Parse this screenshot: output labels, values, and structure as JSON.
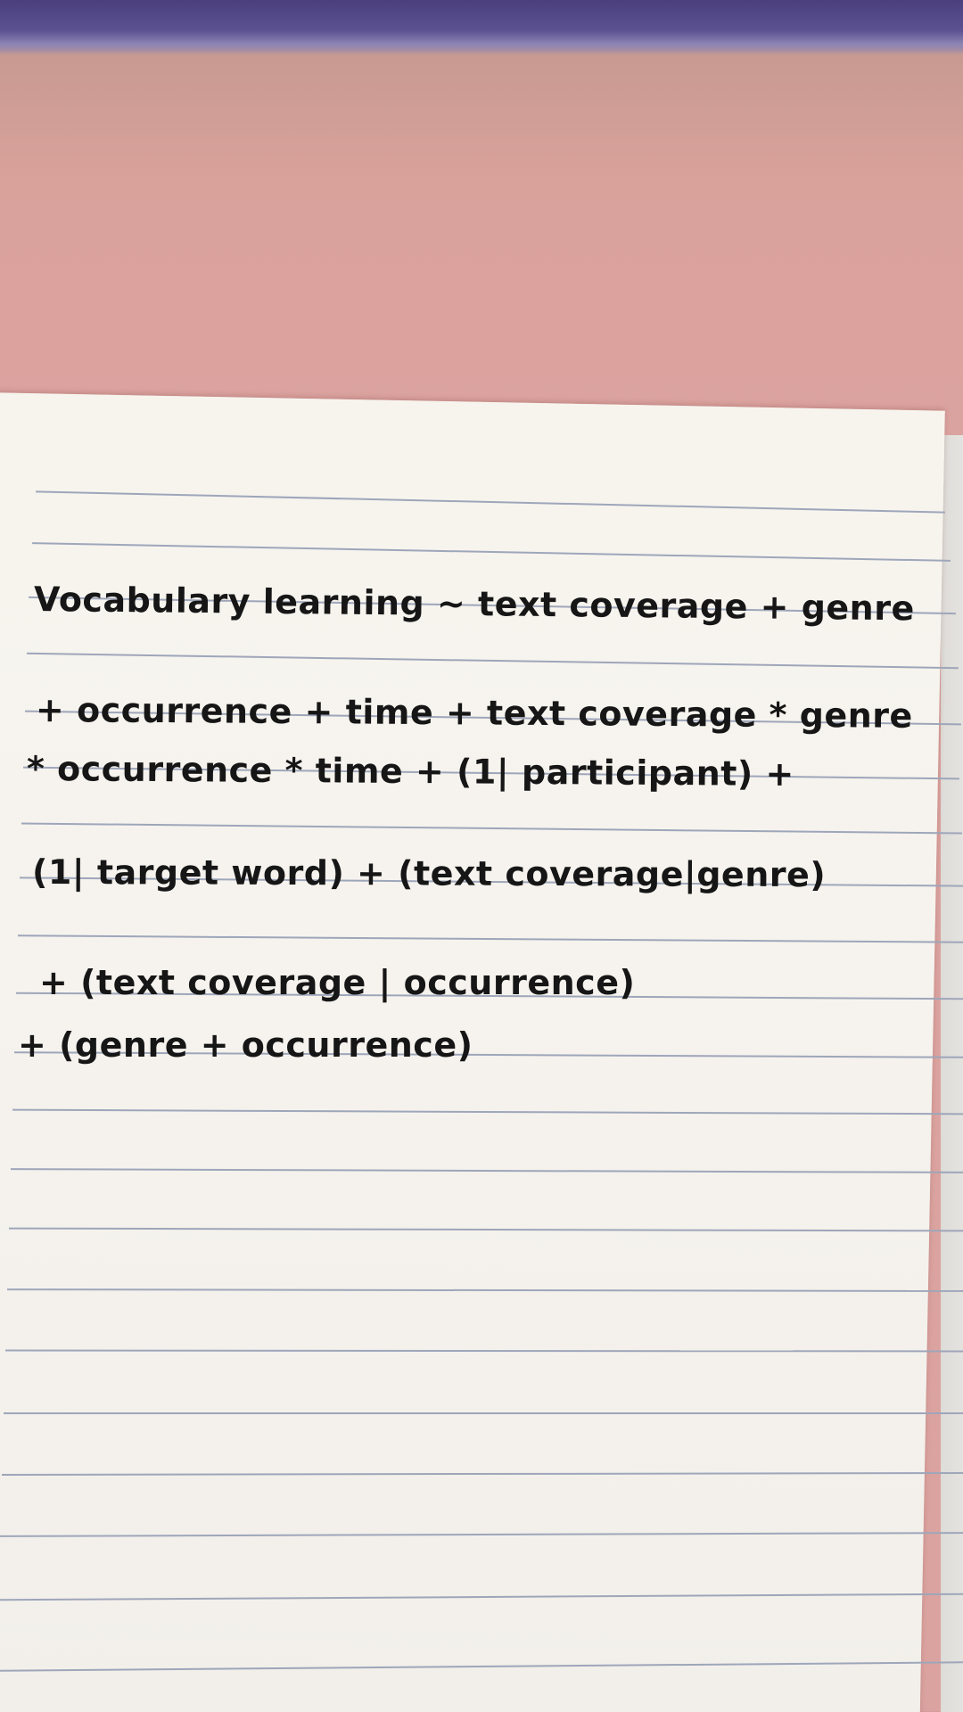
{
  "notebook": {
    "lines": [
      "Vocabulary learning ~ text coverage + genre",
      "+ occurrence + time + text coverage * genre",
      "* occurrence * time + (1| participant) +",
      "(1| target word) + (text coverage|genre)",
      "+ (text coverage | occurrence)",
      "+ (genre + occurrence)"
    ]
  },
  "colors": {
    "background": "#dca39e",
    "fabric": "#5b5191",
    "paper": "#f6f3ee",
    "rule_line": "#9ea6ba",
    "ink": "#161616"
  }
}
